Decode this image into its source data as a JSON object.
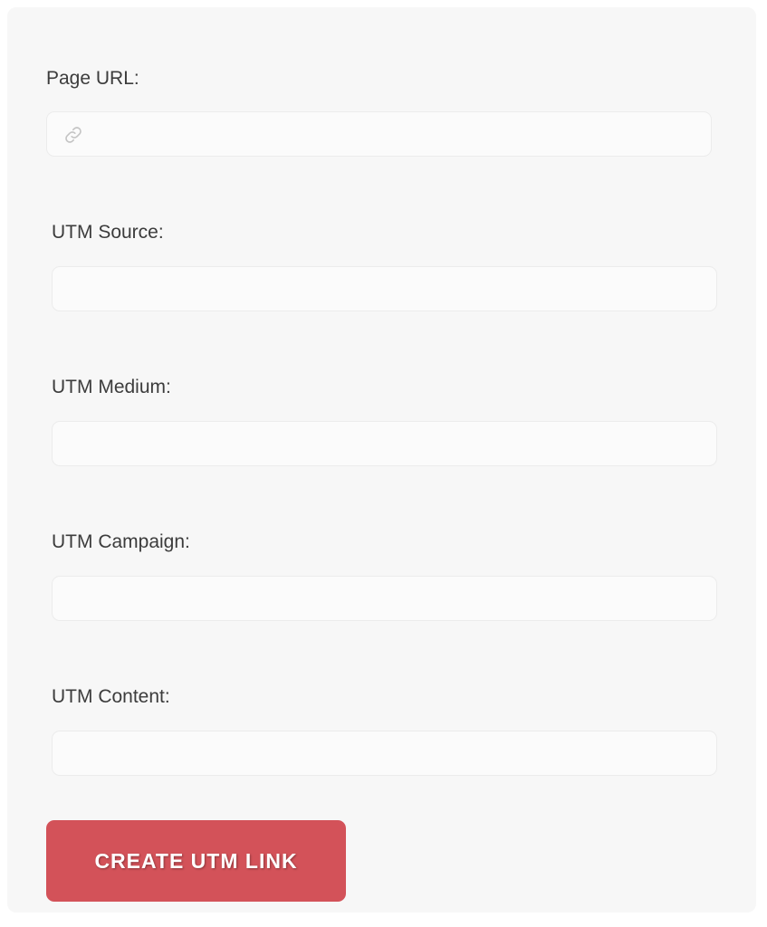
{
  "form": {
    "fields": [
      {
        "label": "Page URL:",
        "value": "",
        "placeholder": "",
        "icon": "link-icon"
      },
      {
        "label": "UTM Source:",
        "value": "",
        "placeholder": ""
      },
      {
        "label": "UTM Medium:",
        "value": "",
        "placeholder": ""
      },
      {
        "label": "UTM Campaign:",
        "value": "",
        "placeholder": ""
      },
      {
        "label": "UTM Content:",
        "value": "",
        "placeholder": ""
      }
    ],
    "submit_label": "CREATE UTM LINK"
  },
  "colors": {
    "card_background": "#f7f7f7",
    "input_background": "#fbfbfb",
    "button_background": "#d35259",
    "button_text": "#ffffff",
    "label_text": "#3c3c3c"
  }
}
